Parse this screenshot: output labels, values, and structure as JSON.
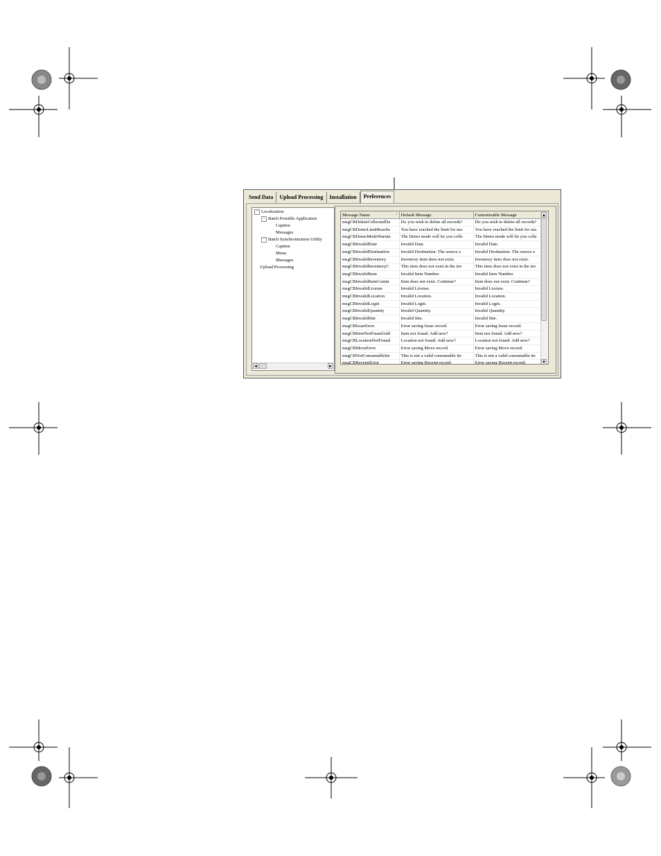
{
  "tabs": [
    {
      "label": "Send Data"
    },
    {
      "label": "Upload Processing"
    },
    {
      "label": "Installation"
    },
    {
      "label": "Preferences"
    }
  ],
  "tree": {
    "nodes": [
      {
        "label": "Localization",
        "expander": "−"
      },
      {
        "label": "Batch Portable Application",
        "expander": "−"
      },
      {
        "label": "Caption"
      },
      {
        "label": "Messages"
      },
      {
        "label": "Batch Synchronization Utility",
        "expander": "−"
      },
      {
        "label": "Caption"
      },
      {
        "label": "Menu"
      },
      {
        "label": "Messages"
      },
      {
        "label": "Upload Processing"
      }
    ]
  },
  "grid": {
    "columns": [
      "Message Name",
      "Default Message",
      "Customizable Message"
    ],
    "sort_glyph": "↓",
    "rows": [
      [
        "msgCBDeleteCollectedDa",
        "Do you wish to delete all records?",
        "Do you wish to delete all records?"
      ],
      [
        "msgCBDemoLimitReache",
        "You have reached the limit for ma",
        "You have reached the limit for ma"
      ],
      [
        "msgCBDemoModeWarnin",
        "The Demo mode will let you colle",
        "The Demo mode will let you colle"
      ],
      [
        "msgCBInvalidDate",
        "Invalid Date.",
        "Invalid Date."
      ],
      [
        "msgCBInvalidDestination",
        "Invalid Destination. The source a",
        "Invalid Destination. The source a"
      ],
      [
        "msgCBInvalidInventory",
        "Inventory item does not exist.",
        "Inventory item does not exist."
      ],
      [
        "msgCBInvalidInventoryC",
        "This item does not exist in the inv",
        "This item does not exist in the inv"
      ],
      [
        "msgCBInvalidItem",
        "Invalid Item Number.",
        "Invalid Item Number."
      ],
      [
        "msgCBInvalidItemContin",
        "Item does not exist. Continue?",
        "Item does not exist. Continue?"
      ],
      [
        "msgCBInvalidLicense",
        "Invalid License.",
        "Invalid License."
      ],
      [
        "msgCBInvalidLocation",
        "Invalid Location.",
        "Invalid Location."
      ],
      [
        "msgCBInvalidLogin",
        "Invalid Login.",
        "Invalid Login."
      ],
      [
        "msgCBInvalidQuantity",
        "Invalid Quantity.",
        "Invalid Quantity."
      ],
      [
        "msgCBInvalidSite",
        "Invalid Site.",
        "Invalid Site."
      ],
      [
        "msgCBIssueError",
        "Error saving Issue record.",
        "Error saving Issue record."
      ],
      [
        "msgCBItemNotFoundAdd",
        "Item not found. Add new?",
        "Item not found. Add new?"
      ],
      [
        "msgCBLocationNotFound",
        "Location not found. Add new?",
        "Location not found. Add new?"
      ],
      [
        "msgCBMoveError",
        "Error saving Move record.",
        "Error saving Move record."
      ],
      [
        "msgCBNotConsumableIte",
        "This is not a valid consumable ite",
        "This is not a valid consumable ite"
      ],
      [
        "msgCBReceiptError",
        "Error saving Receipt record.",
        "Error saving Receipt record."
      ]
    ]
  },
  "scroll": {
    "up": "▲",
    "down": "▼",
    "left": "◄",
    "right": "►"
  }
}
